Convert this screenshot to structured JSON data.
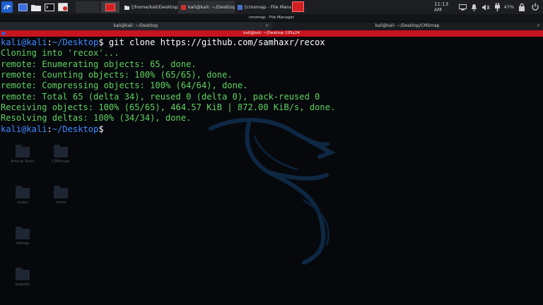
{
  "panel": {
    "tasks": [
      {
        "label": "[/home/kali/Desktop/CM...",
        "icon": "folder-icon",
        "color": "#f0f0f0"
      },
      {
        "label": "kali@kali: ~/Desktop",
        "icon": "terminal-icon",
        "color": "#d03030"
      },
      {
        "label": "[cmsmap - File Manager]",
        "icon": "file-manager-icon",
        "color": "#4a6fd0"
      }
    ],
    "clock": "11:13 AM",
    "battery": "47%"
  },
  "window": {
    "title": "cmsmap - File Manager"
  },
  "tabs": [
    {
      "label": "kali@kali: ~/Desktop"
    },
    {
      "label": "kali@kali: ~/Desktop/CMSmap"
    }
  ],
  "active_title": "kali@kali: ~/Desktop 105x24",
  "terminal": {
    "user": "kali@kali",
    "sep": ":",
    "path": "~/Desktop",
    "prompt_char": "$",
    "command": " git clone https://github.com/samhaxr/recox",
    "output": [
      "Cloning into 'recox'...",
      "remote: Enumerating objects: 65, done.",
      "remote: Counting objects: 100% (65/65), done.",
      "remote: Compressing objects: 100% (64/64), done.",
      "remote: Total 65 (delta 34), reused 0 (delta 0), pack-reused 0",
      "Receiving objects: 100% (65/65), 464.57 KiB | 872.00 KiB/s, done.",
      "Resolving deltas: 100% (34/34), done."
    ]
  },
  "desktop_icons": [
    {
      "label": "Article Tools"
    },
    {
      "label": "CMSmap"
    },
    {
      "label": "xssbo"
    },
    {
      "label": "recox"
    },
    {
      "label": "sdmap"
    },
    {
      "label": "pagodo"
    }
  ]
}
